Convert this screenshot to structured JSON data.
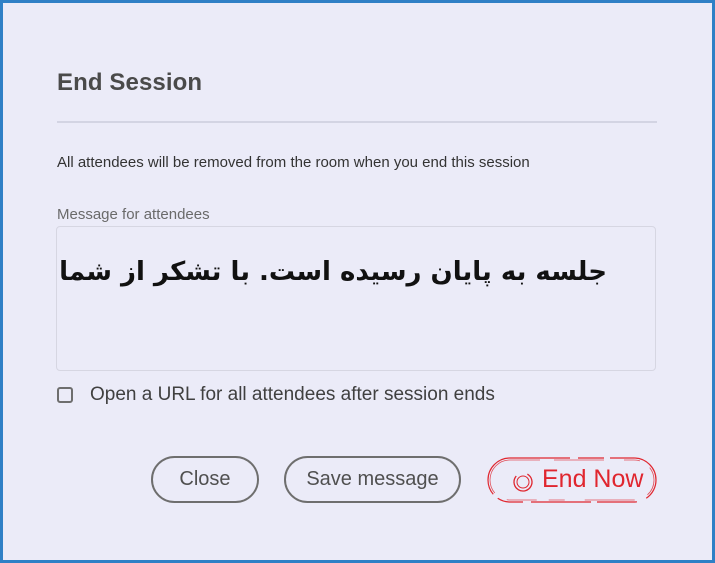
{
  "dialog": {
    "title": "End Session",
    "description": "All attendees will be removed from the room when you end this session",
    "message_label": "Message for attendees",
    "message_value": "جلسه به پایان رسیده است. با تشکر از شما",
    "checkbox_label": "Open a URL for all attendees after session ends",
    "checkbox_checked": false
  },
  "buttons": {
    "close_label": "Close",
    "save_label": "Save message",
    "end_now_label": "End Now"
  },
  "colors": {
    "frame": "#2f80c6",
    "background": "#ebebf8",
    "end_now": "#e0262f"
  },
  "icons": {
    "end_now": "power-icon",
    "checkbox": "checkbox-unchecked-icon"
  }
}
